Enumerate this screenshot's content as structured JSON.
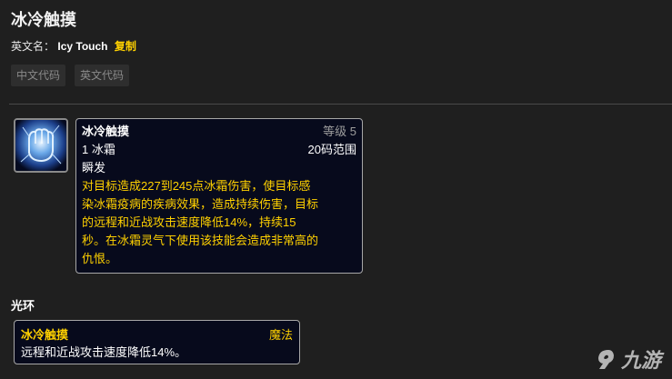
{
  "header": {
    "title": "冰冷触摸",
    "en_label": "英文名：",
    "en_value": "Icy Touch",
    "copy_label": "复制"
  },
  "code_buttons": [
    "中文代码",
    "英文代码"
  ],
  "tooltip": {
    "name": "冰冷触摸",
    "level": "等级 5",
    "cost": "1 冰霜",
    "range": "20码范围",
    "cast": "瞬发",
    "description_lines": [
      "对目标造成227到245点冰霜伤害，使目标感",
      "染冰霜疫病的疾病效果，造成持续伤害，目标",
      "的远程和近战攻击速度降低14%，持续15",
      "秒。在冰霜灵气下使用该技能会造成非常高的",
      "仇恨。"
    ]
  },
  "aura_section": {
    "title": "光环",
    "name": "冰冷触摸",
    "type": "魔法",
    "description": "远程和近战攻击速度降低14%。"
  },
  "watermark": {
    "text": "九游"
  },
  "colors": {
    "background": "#1f1f1f",
    "tooltip_bg": "#070a1c",
    "gold": "#ffd100",
    "border": "#a7a7a7"
  }
}
